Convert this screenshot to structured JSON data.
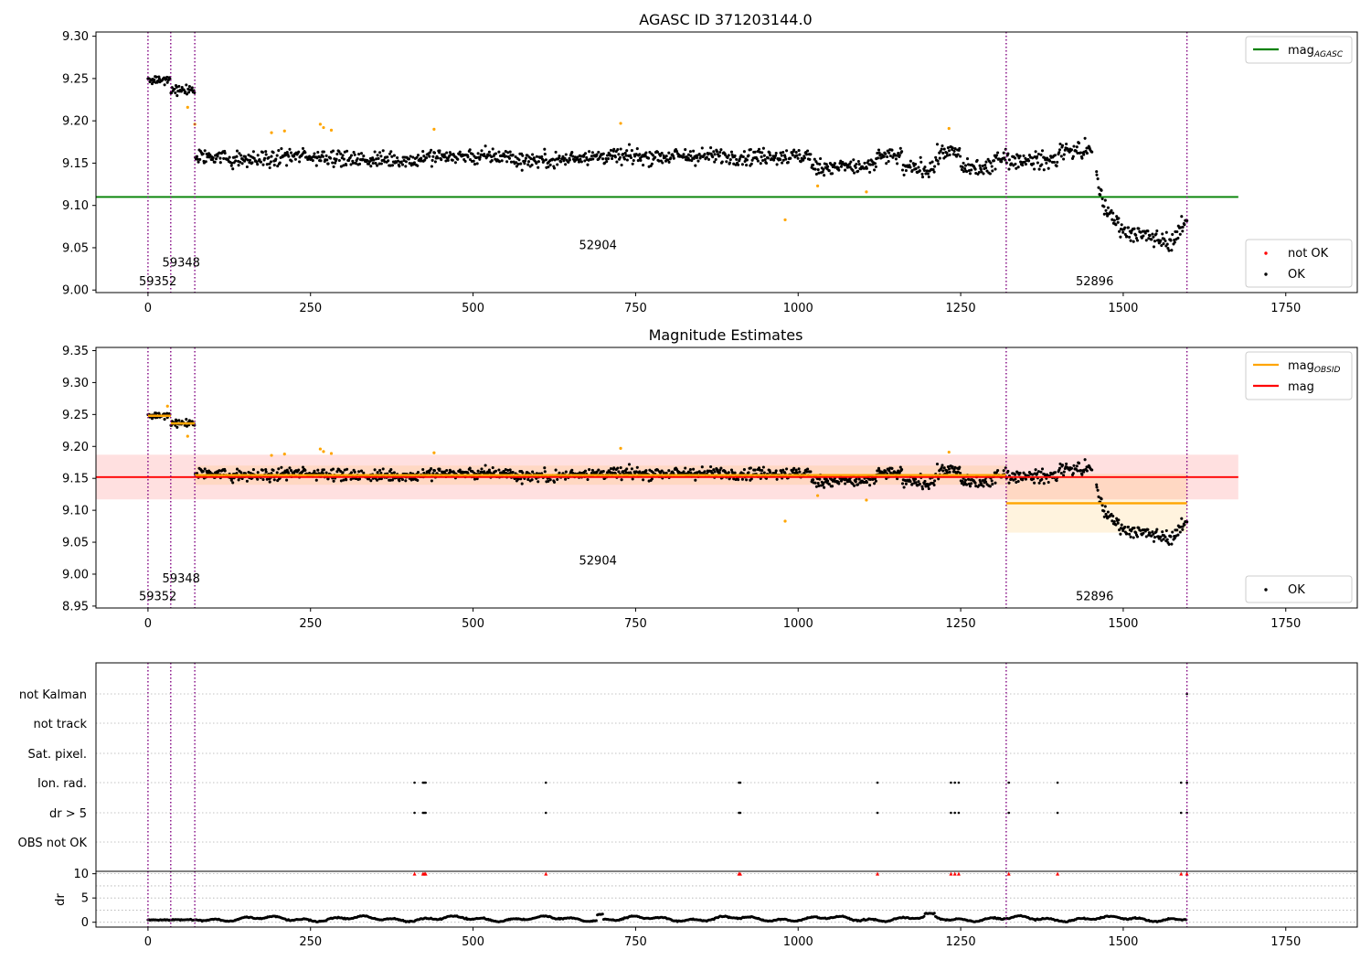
{
  "chart_data": [
    {
      "type": "scatter",
      "title": "AGASC ID 371203144.0",
      "xlim": [
        -80,
        1860
      ],
      "ylim": [
        8.997,
        9.305
      ],
      "xticks": [
        0,
        250,
        500,
        750,
        1000,
        1250,
        1500,
        1750
      ],
      "yticks": [
        9.0,
        9.05,
        9.1,
        9.15,
        9.2,
        9.25,
        9.3
      ],
      "ytick_decimals": 2,
      "obs_boundaries": [
        0,
        35,
        72,
        1320,
        1598
      ],
      "obs_labels": [
        {
          "text": "59352",
          "x": -14,
          "y": 9.011
        },
        {
          "text": "59348",
          "x": 22,
          "y": 9.033
        },
        {
          "text": "52904",
          "x": 663,
          "y": 9.054
        },
        {
          "text": "52896",
          "x": 1427,
          "y": 9.011
        }
      ],
      "mag_agasc": {
        "value": 9.11,
        "x_range": [
          -80,
          1677
        ],
        "color": "#008000"
      },
      "series": [
        {
          "name": "OK",
          "color": "#000000",
          "ref": "ok"
        },
        {
          "name": "not OK",
          "color": "#ff0000",
          "ref": "notok"
        }
      ],
      "outliers_orange": [
        [
          61,
          9.216
        ],
        [
          72,
          9.196
        ],
        [
          190,
          9.186
        ],
        [
          210,
          9.188
        ],
        [
          265,
          9.196
        ],
        [
          270,
          9.192
        ],
        [
          282,
          9.189
        ],
        [
          440,
          9.19
        ],
        [
          727,
          9.197
        ],
        [
          980,
          9.083
        ],
        [
          1030,
          9.123
        ],
        [
          1105,
          9.116
        ],
        [
          1232,
          9.191
        ]
      ],
      "legend_top": [
        {
          "label": "mag",
          "sub": "AGASC",
          "color": "#008000"
        }
      ],
      "legend_bottom": [
        {
          "label": "not OK",
          "color": "#ff0000"
        },
        {
          "label": "OK",
          "color": "#000000"
        }
      ]
    },
    {
      "type": "scatter",
      "title": "Magnitude Estimates",
      "xlim": [
        -80,
        1860
      ],
      "ylim": [
        8.947,
        9.355
      ],
      "xticks": [
        0,
        250,
        500,
        750,
        1000,
        1250,
        1500,
        1750
      ],
      "yticks": [
        8.95,
        9.0,
        9.05,
        9.1,
        9.15,
        9.2,
        9.25,
        9.3,
        9.35
      ],
      "ytick_decimals": 2,
      "obs_boundaries": [
        0,
        35,
        72,
        1320,
        1598
      ],
      "obs_labels": [
        {
          "text": "59352",
          "x": -14,
          "y": 8.966
        },
        {
          "text": "59348",
          "x": 22,
          "y": 8.994
        },
        {
          "text": "52904",
          "x": 663,
          "y": 9.022
        },
        {
          "text": "52896",
          "x": 1427,
          "y": 8.966
        }
      ],
      "mag": {
        "value": 9.152,
        "band": [
          9.117,
          9.187
        ],
        "x_range": [
          -80,
          1677
        ],
        "color": "#ff0000"
      },
      "mag_obsid": [
        {
          "x": [
            0,
            35
          ],
          "value": 9.248,
          "band": [
            9.242,
            9.254
          ]
        },
        {
          "x": [
            35,
            72
          ],
          "value": 9.236,
          "band": [
            9.23,
            9.242
          ]
        },
        {
          "x": [
            72,
            1320
          ],
          "value": 9.155,
          "band": [
            9.14,
            9.17
          ]
        },
        {
          "x": [
            1320,
            1598
          ],
          "value": 9.111,
          "band": [
            9.065,
            9.157
          ]
        }
      ],
      "outliers_orange": [
        [
          30,
          9.263
        ],
        [
          61,
          9.216
        ],
        [
          190,
          9.186
        ],
        [
          210,
          9.188
        ],
        [
          265,
          9.196
        ],
        [
          270,
          9.192
        ],
        [
          282,
          9.189
        ],
        [
          440,
          9.19
        ],
        [
          727,
          9.197
        ],
        [
          980,
          9.083
        ],
        [
          1030,
          9.123
        ],
        [
          1105,
          9.116
        ],
        [
          1232,
          9.191
        ]
      ],
      "legend_top": [
        {
          "label": "mag",
          "sub": "OBSID",
          "color": "#ffa500"
        },
        {
          "label": "mag",
          "sub": "",
          "color": "#ff0000"
        }
      ],
      "legend_bottom": [
        {
          "label": "OK",
          "color": "#000000"
        }
      ]
    },
    {
      "type": "scatter",
      "title": "",
      "xlim": [
        -80,
        1860
      ],
      "xticks": [
        0,
        250,
        500,
        750,
        1000,
        1250,
        1500,
        1750
      ],
      "obs_boundaries": [
        0,
        35,
        72,
        1320,
        1598
      ],
      "flag_rows": [
        "not Kalman",
        "not track",
        "Sat. pixel.",
        "Ion. rad.",
        "dr > 5",
        "OBS not OK"
      ],
      "flag_points": {
        "not Kalman": [
          1598
        ],
        "Ion. rad.": [
          410,
          423,
          425,
          427,
          612,
          909,
          911,
          1122,
          1235,
          1241,
          1247,
          1324,
          1399,
          1589,
          1598
        ],
        "dr > 5": [
          410,
          423,
          425,
          427,
          612,
          909,
          911,
          1122,
          1235,
          1241,
          1247,
          1324,
          1399,
          1589,
          1598
        ]
      },
      "dr": {
        "ylabel": "dr",
        "ylim": [
          -1,
          10.5
        ],
        "yticks": [
          0,
          5,
          10
        ],
        "high_points": [
          410,
          423,
          425,
          427,
          612,
          909,
          911,
          1122,
          1235,
          1241,
          1247,
          1324,
          1399,
          1589,
          1598
        ]
      }
    }
  ]
}
